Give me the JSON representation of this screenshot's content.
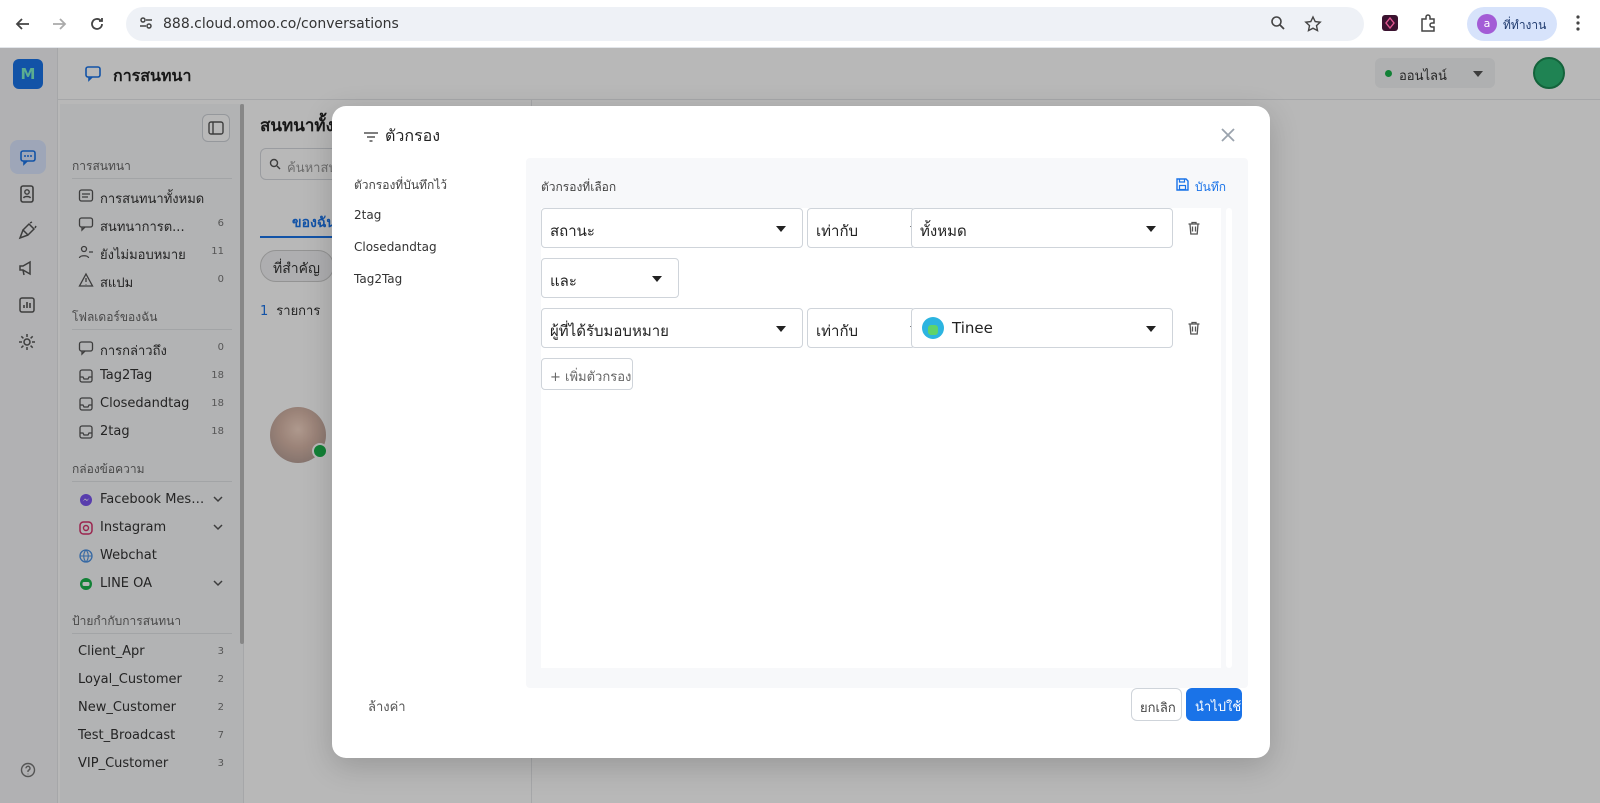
{
  "browser": {
    "url": "888.cloud.omoo.co/conversations",
    "profile_initial": "a",
    "profile_name": "ที่ทำงาน"
  },
  "app": {
    "header_title": "การสนทนา",
    "status": "ออนไลน์"
  },
  "sidebar": {
    "section_conversations": "การสนทนา",
    "items": [
      {
        "label": "การสนทนาทั้งหมด",
        "count": ""
      },
      {
        "label": "สนทนาการต...",
        "count": "6"
      },
      {
        "label": "ยังไม่มอบหมาย",
        "count": "11"
      },
      {
        "label": "สแปม",
        "count": "0"
      }
    ],
    "section_folders": "โฟลเดอร์ของฉัน",
    "folders": [
      {
        "label": "การกล่าวถึง",
        "count": "0"
      },
      {
        "label": "Tag2Tag",
        "count": "18"
      },
      {
        "label": "Closedandtag",
        "count": "18"
      },
      {
        "label": "2tag",
        "count": "18"
      }
    ],
    "section_inbox": "กล่องข้อความ",
    "inboxes": [
      {
        "label": "Facebook Messa..."
      },
      {
        "label": "Instagram"
      },
      {
        "label": "Webchat"
      },
      {
        "label": "LINE OA"
      }
    ],
    "section_labels": "ป้ายกำกับการสนทนา",
    "labels": [
      {
        "label": "Client_Apr",
        "count": "3"
      },
      {
        "label": "Loyal_Customer",
        "count": "2"
      },
      {
        "label": "New_Customer",
        "count": "2"
      },
      {
        "label": "Test_Broadcast",
        "count": "7"
      },
      {
        "label": "VIP_Customer",
        "count": "3"
      }
    ]
  },
  "convlist": {
    "heading": "สนทนาทั้งห",
    "search_placeholder": "ค้นหาสน",
    "tab_mine": "ของฉัน",
    "chip_important": "ที่สำคัญ",
    "count": "1",
    "count_label": "รายการ"
  },
  "modal": {
    "title": "ตัวกรอง",
    "saved_header": "ตัวกรองที่บันทึกไว้",
    "saved_items": [
      "2tag",
      "Closedandtag",
      "Tag2Tag"
    ],
    "selected_header": "ตัวกรองที่เลือก",
    "save_label": "บันทึก",
    "rows": [
      {
        "field": "สถานะ",
        "operator": "เท่ากับ",
        "value": "ทั้งหมด"
      },
      {
        "field": "ผู้ที่ได้รับมอบหมาย",
        "operator": "เท่ากับ",
        "value": "Tinee"
      }
    ],
    "conjunction": "และ",
    "add_filter": "+ เพิ่มตัวกรอง",
    "reset": "ล้างค่า",
    "cancel": "ยกเลิก",
    "apply": "นำไปใช้"
  }
}
